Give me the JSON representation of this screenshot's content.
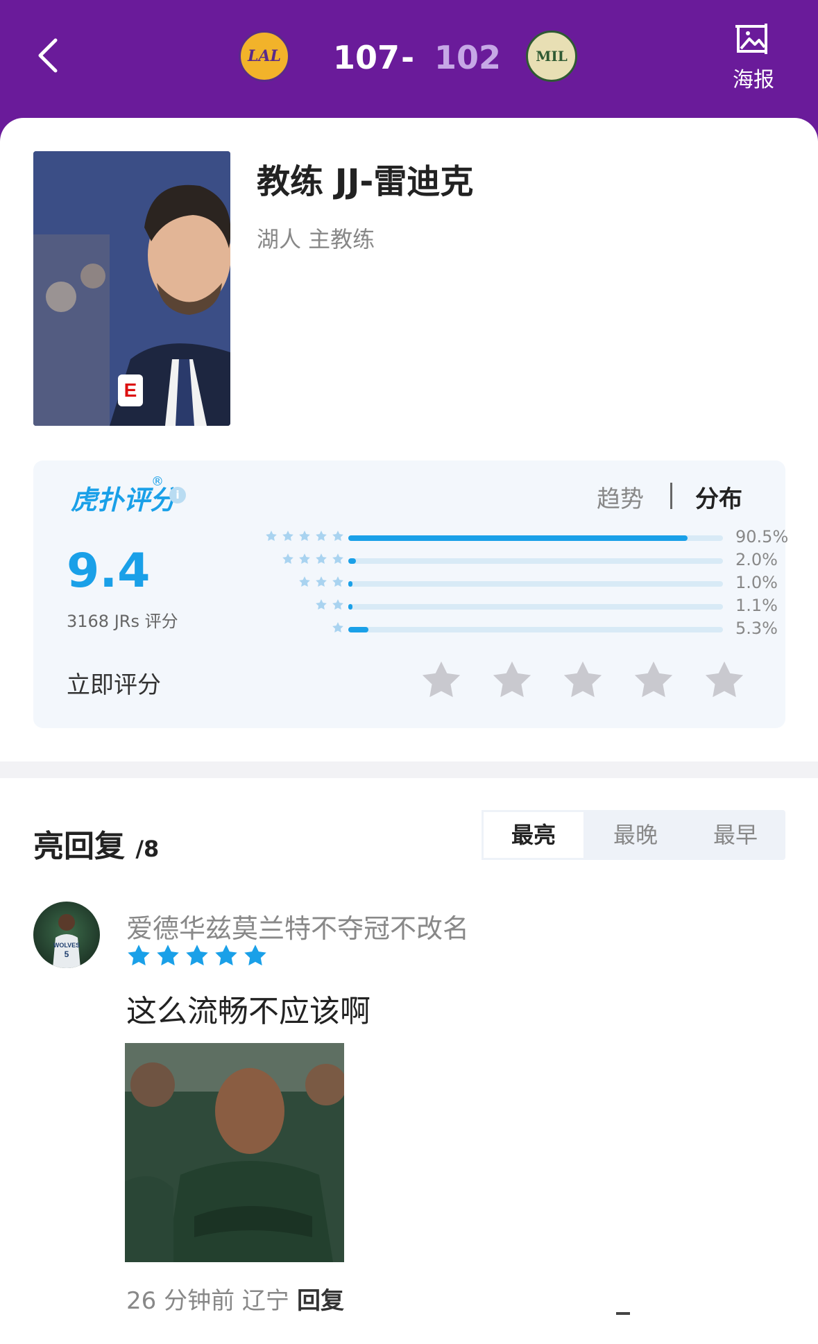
{
  "header": {
    "home_team": "LAL",
    "home_score": "107",
    "score_separator": "-",
    "away_score": "102",
    "away_team": "MIL",
    "poster_label": "海报",
    "colors": {
      "background": "#6a1b9a",
      "away_score": "#c6a8e6"
    }
  },
  "profile": {
    "name": "教练 JJ-雷迪克",
    "role": "湖人 主教练"
  },
  "rating": {
    "brand": "虎扑评分",
    "tabs": {
      "trend": "趋势",
      "distribution": "分布"
    },
    "score": "9.4",
    "count_label": "3168 JRs 评分",
    "distribution": [
      {
        "stars": 5,
        "percent": 90.5,
        "label": "90.5%"
      },
      {
        "stars": 4,
        "percent": 2.0,
        "label": "2.0%"
      },
      {
        "stars": 3,
        "percent": 1.0,
        "label": "1.0%"
      },
      {
        "stars": 2,
        "percent": 1.1,
        "label": "1.1%"
      },
      {
        "stars": 1,
        "percent": 5.3,
        "label": "5.3%"
      }
    ],
    "rate_now_label": "立即评分",
    "accent_color": "#1aa0e8"
  },
  "replies": {
    "title": "亮回复",
    "count": "/8",
    "sort_tabs": [
      "最亮",
      "最晚",
      "最早"
    ],
    "active_sort": "最亮",
    "items": [
      {
        "username": "爱德华兹莫兰特不夺冠不改名",
        "stars": 5,
        "text": "这么流畅不应该啊",
        "meta": "26 分钟前 辽宁",
        "reply_label": "回复"
      }
    ]
  }
}
